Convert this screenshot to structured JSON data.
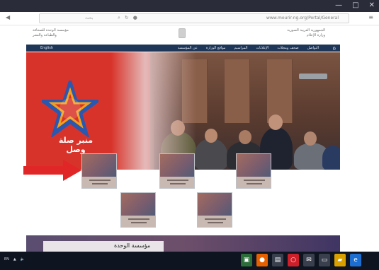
{
  "browser": {
    "url": "www.mourir-ng.org/Portal/General",
    "search_placeholder": "بحث",
    "window_controls": {
      "minimize": "—",
      "maximize": "□",
      "close": "✕"
    },
    "icons": [
      "back-icon",
      "search-icon",
      "refresh-icon",
      "settings-icon",
      "menu-icon"
    ]
  },
  "header": {
    "right_line1": "الجمهورية العربية السورية",
    "right_line2": "وزارة الإعلام",
    "left_line1": "مؤسسة الوحدة للصحافة",
    "left_line2": "والطباعة والنشر"
  },
  "nav": {
    "home_icon": "⌂",
    "items": [
      "عن المؤسسة",
      "مواقع الوزارة",
      "المراسيم",
      "الإعلانات",
      "صحف ومجلات",
      "التواصل"
    ],
    "left_item": "English"
  },
  "hero": {
    "logo_text": "منبر صلة وصل"
  },
  "thumbnails": [
    {
      "caption": "صحيفة الثورة"
    },
    {
      "caption": "صحيفة تشرين"
    },
    {
      "caption": "صحيفة الوحدة"
    },
    {
      "caption": "صحيفة الفداء"
    },
    {
      "caption": "صحيفة العروبة"
    }
  ],
  "bottom": {
    "banner_text": "مؤسسة الوحدة"
  },
  "taskbar": {
    "left_items": [
      "EN",
      "▲",
      "🔈"
    ],
    "icons": [
      "Firefox",
      "Files",
      "Opera",
      "Mail",
      "Store",
      "Edge"
    ]
  },
  "colors": {
    "nav_bg": "#1e3657",
    "hero_red": "#d8332a",
    "arrow_red": "#e02626",
    "taskbar_bg": "#0f1421"
  }
}
